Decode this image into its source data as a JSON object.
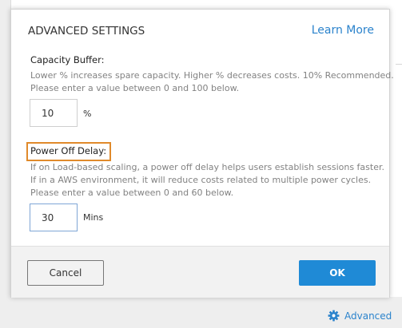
{
  "dialog": {
    "title": "ADVANCED SETTINGS",
    "learn_more": "Learn More",
    "capacity": {
      "label": "Capacity Buffer:",
      "desc": [
        "Lower % increases spare capacity. Higher % decreases costs. 10% Recommended.",
        "Please enter a value between 0 and 100 below."
      ],
      "value": "10",
      "unit": "%"
    },
    "power_off": {
      "label": "Power Off Delay:",
      "desc": [
        "If on Load-based scaling, a power off delay helps users establish sessions faster.",
        "If in a AWS environment, it will reduce costs related to multiple power cycles.",
        "Please enter a value between 0 and 60 below."
      ],
      "value": "30",
      "unit": "Mins"
    },
    "buttons": {
      "cancel": "Cancel",
      "ok": "OK"
    }
  },
  "advanced_link": {
    "label": "Advanced",
    "icon": "gear-icon"
  },
  "colors": {
    "accent": "#2b83cc",
    "ok_button": "#1f8ad6",
    "highlight": "#e08a2b"
  }
}
